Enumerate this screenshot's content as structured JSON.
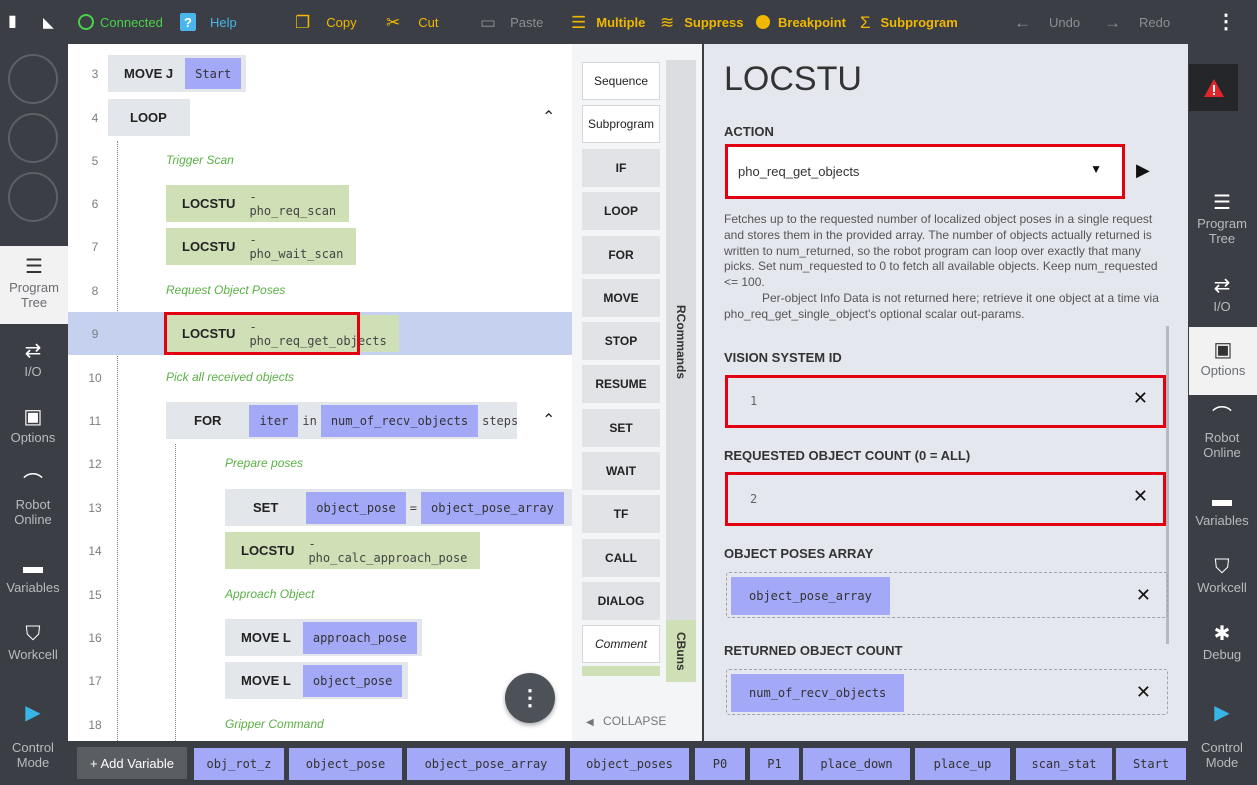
{
  "toolbar": {
    "connected": "Connected",
    "help": "Help",
    "copy": "Copy",
    "cut": "Cut",
    "paste": "Paste",
    "multiple": "Multiple",
    "suppress": "Suppress",
    "breakpoint": "Breakpoint",
    "subprogram": "Subprogram",
    "undo": "Undo",
    "redo": "Redo"
  },
  "left_nav": {
    "program_tree": "Program Tree",
    "io": "I/O",
    "options": "Options",
    "robot_online": "Robot Online",
    "variables": "Variables",
    "workcell": "Workcell",
    "control_mode": "Control Mode"
  },
  "right_nav": {
    "program_tree": "Program Tree",
    "io": "I/O",
    "options": "Options",
    "robot_online": "Robot Online",
    "variables": "Variables",
    "workcell": "Workcell",
    "debug": "Debug",
    "control_mode": "Control Mode"
  },
  "tree": {
    "rows": [
      {
        "n": "3",
        "cmd": "MOVE J",
        "arg": "Start"
      },
      {
        "n": "4",
        "cmd": "LOOP"
      },
      {
        "n": "5",
        "comment": "Trigger Scan"
      },
      {
        "n": "6",
        "cmd": "LOCSTU",
        "arg": "- pho_req_scan"
      },
      {
        "n": "7",
        "cmd": "LOCSTU",
        "arg": "- pho_wait_scan"
      },
      {
        "n": "8",
        "comment": "Request Object Poses"
      },
      {
        "n": "9",
        "cmd": "LOCSTU",
        "arg": "- pho_req_get_objects"
      },
      {
        "n": "10",
        "comment": "Pick all received objects"
      },
      {
        "n": "11",
        "cmd": "FOR",
        "var": "iter",
        "in": "in",
        "count": "num_of_recv_objects",
        "steps": "steps"
      },
      {
        "n": "12",
        "comment": "Prepare poses"
      },
      {
        "n": "13",
        "cmd": "SET",
        "lhs": "object_pose",
        "eq": "=",
        "rhs": "object_pose_array",
        "br": "["
      },
      {
        "n": "14",
        "cmd": "LOCSTU",
        "arg": "- pho_calc_approach_pose"
      },
      {
        "n": "15",
        "comment": "Approach Object"
      },
      {
        "n": "16",
        "cmd": "MOVE L",
        "arg": "approach_pose"
      },
      {
        "n": "17",
        "cmd": "MOVE L",
        "arg": "object_pose"
      },
      {
        "n": "18",
        "comment": "Gripper Command"
      }
    ]
  },
  "commands": {
    "items": [
      "Sequence",
      "Subprogram",
      "IF",
      "LOOP",
      "FOR",
      "MOVE",
      "STOP",
      "RESUME",
      "SET",
      "WAIT",
      "TF",
      "CALL",
      "DIALOG",
      "Comment"
    ],
    "tab_rcommands": "RCommands",
    "tab_cbuns": "CBuns",
    "collapse": "COLLAPSE"
  },
  "properties": {
    "title": "LOCSTU",
    "action_label": "ACTION",
    "action_value": "pho_req_get_objects",
    "description": "Fetches up to the requested number of localized object poses in a single request and stores them in the provided array. The number of objects actually returned is written to num_returned, so the robot program can loop over exactly that many picks. Set num_requested to 0 to fetch all available objects. Keep num_requested <= 100.",
    "description2": "Per-object Info Data is not returned here; retrieve it one object at a time via pho_req_get_single_object's optional scalar out-params.",
    "vision_label": "VISION SYSTEM ID",
    "vision_value": "1",
    "count_label": "REQUESTED OBJECT COUNT (0 = ALL)",
    "count_value": "2",
    "poses_label": "OBJECT POSES ARRAY",
    "poses_value": "object_pose_array",
    "returned_label": "RETURNED OBJECT COUNT",
    "returned_value": "num_of_recv_objects"
  },
  "bottom": {
    "add_variable": "+ Add Variable",
    "vars": [
      "obj_rot_z",
      "object_pose",
      "object_pose_array",
      "object_poses",
      "P0",
      "P1",
      "place_down",
      "place_up",
      "scan_stat",
      "Start"
    ]
  },
  "colors": {
    "accent": "#f0b800",
    "connected": "#4ad24a",
    "help": "#4ab5ec",
    "variable_pill": "#a3a8f7",
    "locstu_block": "#cfe0b6",
    "selected_row": "#c6d1ef",
    "highlight_box": "#e3000f"
  }
}
